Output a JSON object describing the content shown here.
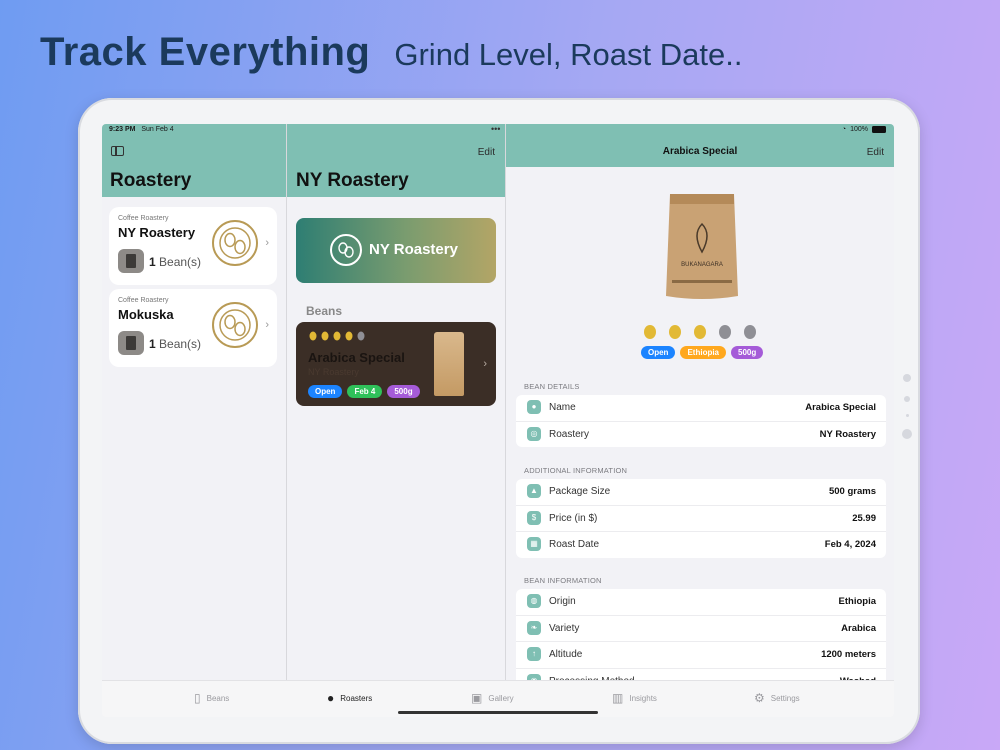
{
  "marketing": {
    "title": "Track Everything",
    "subtitle": "Grind Level, Roast Date.."
  },
  "status": {
    "time": "9:23 PM",
    "date": "Sun Feb 4",
    "battery": "100%",
    "dots": "•••"
  },
  "sidebar": {
    "title": "Roastery",
    "roasteries": [
      {
        "kind": "Coffee Roastery",
        "name": "NY Roastery",
        "count": "1",
        "count_label": "Bean(s)"
      },
      {
        "kind": "Coffee Roastery",
        "name": "Mokuska",
        "count": "1",
        "count_label": "Bean(s)"
      }
    ]
  },
  "middle": {
    "title": "NY Roastery",
    "edit_label": "Edit",
    "banner_title": "NY Roastery",
    "beans_header": "Beans",
    "bean": {
      "name": "Arabica Special",
      "roastery": "NY Roastery",
      "rating": 4,
      "pills": [
        "Open",
        "Feb 4",
        "500g"
      ]
    }
  },
  "detail": {
    "nav_title": "Arabica Special",
    "edit_label": "Edit",
    "bag_brand": "BUKANAGARA",
    "rating": 3,
    "rating_max": 5,
    "pills": [
      "Open",
      "Ethiopia",
      "500g"
    ],
    "bean_details": {
      "header": "BEAN DETAILS",
      "rows": [
        {
          "icon": "bean-icon",
          "label": "Name",
          "value": "Arabica Special"
        },
        {
          "icon": "roastery-icon",
          "label": "Roastery",
          "value": "NY Roastery"
        }
      ]
    },
    "additional": {
      "header": "ADDITIONAL INFORMATION",
      "rows": [
        {
          "icon": "package-icon",
          "label": "Package Size",
          "value": "500 grams"
        },
        {
          "icon": "dollar-icon",
          "label": "Price (in $)",
          "value": "25.99"
        },
        {
          "icon": "calendar-icon",
          "label": "Roast Date",
          "value": "Feb 4, 2024"
        }
      ]
    },
    "bean_info": {
      "header": "BEAN INFORMATION",
      "rows": [
        {
          "icon": "globe-icon",
          "label": "Origin",
          "value": "Ethiopia"
        },
        {
          "icon": "leaf-icon",
          "label": "Variety",
          "value": "Arabica"
        },
        {
          "icon": "arrow-up-icon",
          "label": "Altitude",
          "value": "1200 meters"
        },
        {
          "icon": "process-icon",
          "label": "Processing Method",
          "value": "Washed"
        }
      ]
    }
  },
  "tabs": [
    {
      "label": "Beans",
      "icon": "bag-icon",
      "active": false
    },
    {
      "label": "Roasters",
      "icon": "coffee-bean-icon",
      "active": true
    },
    {
      "label": "Gallery",
      "icon": "gallery-icon",
      "active": false
    },
    {
      "label": "Insights",
      "icon": "chart-icon",
      "active": false
    },
    {
      "label": "Settings",
      "icon": "gear-icon",
      "active": false
    }
  ],
  "colors": {
    "accent": "#7fbfb3",
    "bean_gold": "#e2b935",
    "bean_gray": "#8f8f95"
  }
}
